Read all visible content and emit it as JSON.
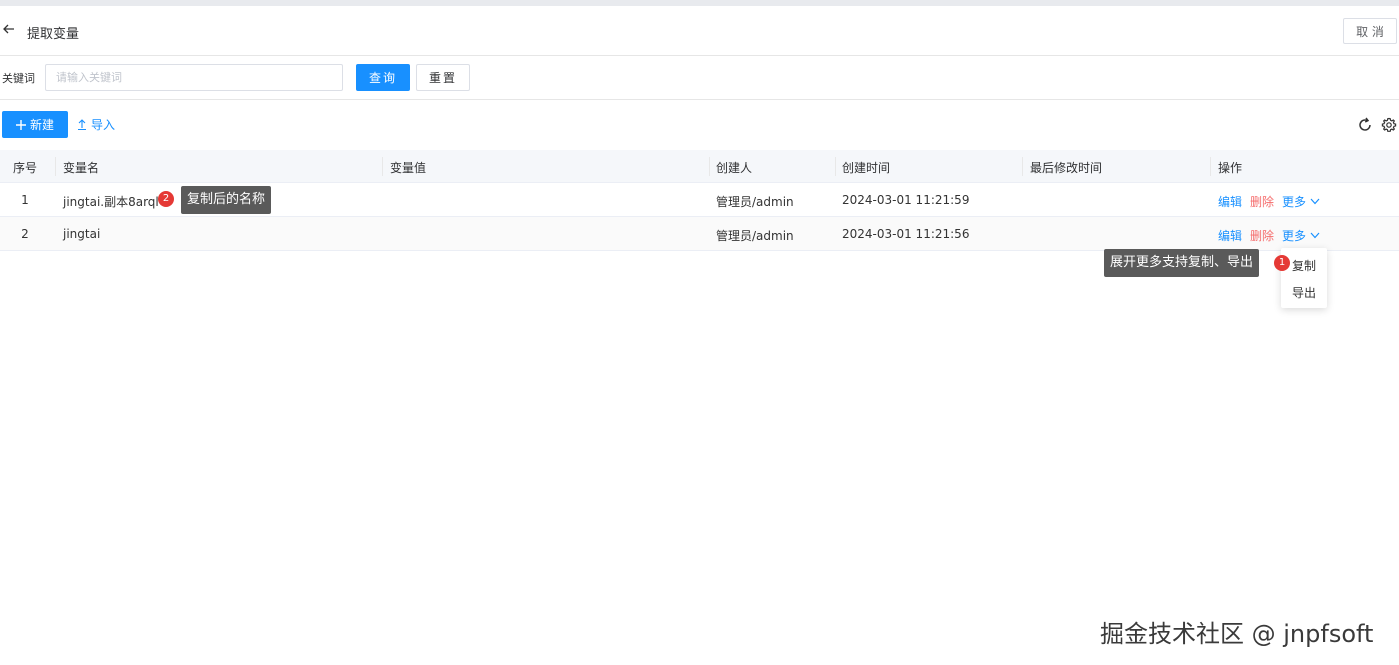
{
  "header": {
    "title": "提取变量",
    "cancel_label": "取 消"
  },
  "filter": {
    "keyword_label": "关键词",
    "keyword_placeholder": "请输入关键词",
    "keyword_value": "",
    "search_label": "查询",
    "reset_label": "重置"
  },
  "toolbar": {
    "new_label": "新建",
    "import_label": "导入"
  },
  "table": {
    "columns": [
      "序号",
      "变量名",
      "变量值",
      "创建人",
      "创建时间",
      "最后修改时间",
      "操作"
    ],
    "rows": [
      {
        "index": "1",
        "name": "jingtai.副本8arql",
        "value": "",
        "creator": "管理员/admin",
        "created": "2024-03-01 11:21:59",
        "modified": ""
      },
      {
        "index": "2",
        "name": "jingtai",
        "value": "",
        "creator": "管理员/admin",
        "created": "2024-03-01 11:21:56",
        "modified": ""
      }
    ],
    "actions": {
      "edit": "编辑",
      "delete": "删除",
      "more": "更多"
    }
  },
  "dropdown": {
    "items": [
      "复制",
      "导出"
    ]
  },
  "annotations": [
    {
      "badge": "1",
      "text": "展开更多支持复制、导出"
    },
    {
      "badge": "2",
      "text": "复制后的名称"
    }
  ],
  "watermark": "掘金技术社区 @ jnpfsoft",
  "colors": {
    "primary": "#1890ff",
    "danger": "#f56c6c",
    "badge": "#e53935",
    "tooltip": "#5a5a5a"
  }
}
